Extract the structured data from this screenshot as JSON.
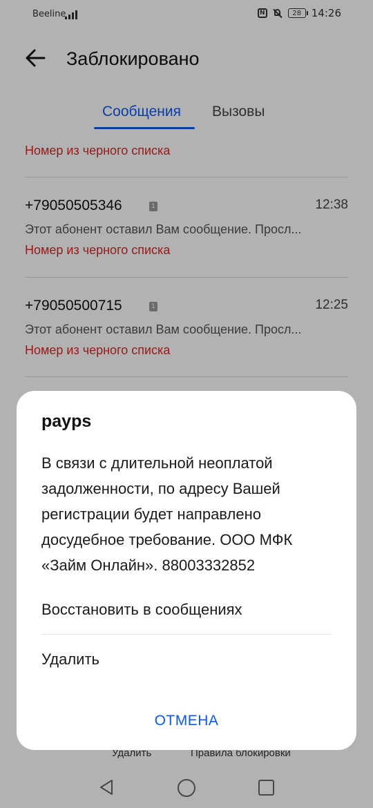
{
  "status_bar": {
    "carrier": "Beeline",
    "battery": "28",
    "time": "14:26"
  },
  "header": {
    "title": "Заблокировано"
  },
  "tabs": [
    {
      "label": "Сообщения",
      "active": true
    },
    {
      "label": "Вызовы",
      "active": false
    }
  ],
  "list": {
    "partial_label": "Номер из черного списка",
    "items": [
      {
        "number": "+79050505346",
        "sim": "1",
        "time": "12:38",
        "preview": "Этот абонент оставил Вам сообщение. Просл...",
        "label": "Номер из черного списка"
      },
      {
        "number": "+79050500715",
        "sim": "1",
        "time": "12:25",
        "preview": "Этот абонент оставил Вам сообщение. Просл...",
        "label": "Номер из черного списка"
      }
    ]
  },
  "bottom_bar": {
    "delete": "Удалить",
    "rules": "Правила блокировки"
  },
  "dialog": {
    "title": "payps",
    "body": "В связи с длительной неоплатой задолженности, по адресу Вашей регистрации будет направлено досудебное требование. ООО МФК «Займ Онлайн». 88003332852",
    "restore": "Восстановить в сообщениях",
    "delete": "Удалить",
    "cancel": "ОТМЕНА"
  },
  "colors": {
    "accent": "#0a59f7",
    "blocked": "#e02424"
  }
}
